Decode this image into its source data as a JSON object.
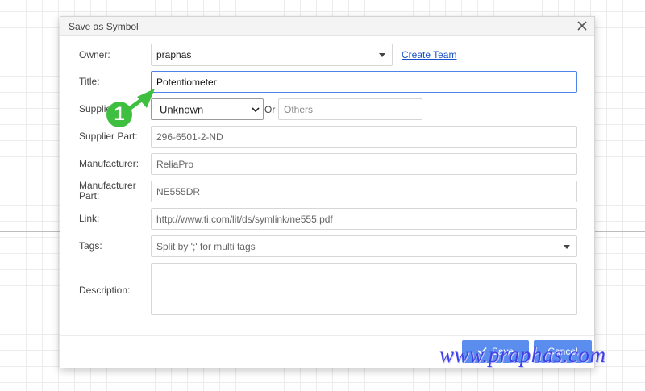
{
  "dialog": {
    "title": "Save as Symbol",
    "fields": {
      "owner": {
        "label": "Owner:",
        "value": "praphas",
        "link": "Create Team"
      },
      "title": {
        "label": "Title:",
        "value": "Potentiometer"
      },
      "supplier": {
        "label": "Supplier:",
        "value": "Unknown",
        "or": "Or",
        "other_placeholder": "Others"
      },
      "supplier_part": {
        "label": "Supplier Part:",
        "value": "296-6501-2-ND"
      },
      "manufacturer": {
        "label": "Manufacturer:",
        "value": "ReliaPro"
      },
      "manufacturer_part": {
        "label_line1": "Manufacturer",
        "label_line2": "Part:",
        "value": "NE555DR"
      },
      "link": {
        "label": "Link:",
        "value": "http://www.ti.com/lit/ds/symlink/ne555.pdf"
      },
      "tags": {
        "label": "Tags:",
        "placeholder": "Split by ';' for multi tags"
      },
      "description": {
        "label": "Description:",
        "value": ""
      }
    },
    "buttons": {
      "save": "Save",
      "cancel": "Cancel"
    }
  },
  "annotation": {
    "step_number": "1",
    "color": "#3fbf3f"
  },
  "watermark": {
    "text": "www.praphas.com"
  },
  "colors": {
    "accent": "#5b8def",
    "link": "#1a53c7",
    "focus_border": "#4f83e8"
  },
  "icons": [
    "close-icon",
    "chevron-down-icon",
    "check-icon"
  ]
}
